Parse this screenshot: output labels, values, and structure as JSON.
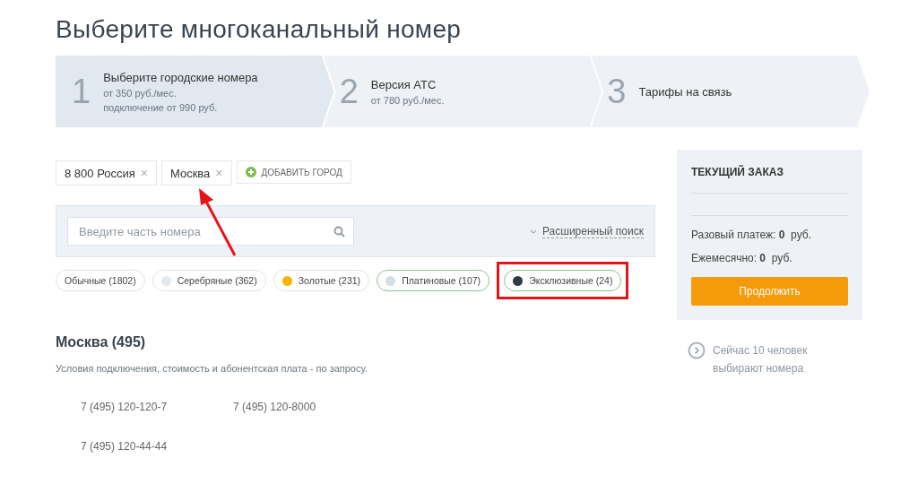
{
  "title": "Выберите многоканальный номер",
  "steps": [
    {
      "number": "1",
      "title": "Выберите городские номера",
      "lines": [
        "от 350 руб./мес.",
        "подключение от 990 руб."
      ],
      "selected": true
    },
    {
      "number": "2",
      "title": "Версия АТС",
      "lines": [
        "от 780 руб./мес."
      ],
      "selected": false
    },
    {
      "number": "3",
      "title": "Тарифы на связь",
      "selected": false
    }
  ],
  "cities": [
    {
      "label": "8 800 Россия",
      "remove": "×"
    },
    {
      "label": "Москва",
      "remove": "×"
    }
  ],
  "add_city": "ДОБАВИТЬ ГОРОД",
  "search": {
    "placeholder": "Введите часть номера",
    "advanced": "Расширенный поиск"
  },
  "categories": [
    {
      "label": "Обычные (1802)",
      "selected": false,
      "highlighted": false
    },
    {
      "label": "Серебряные (362)",
      "color": "#e3e9f0",
      "selected": false,
      "highlighted": false
    },
    {
      "label": "Золотые (231)",
      "color": "#f7b500",
      "selected": false,
      "highlighted": false
    },
    {
      "label": "Платиновые (107)",
      "color": "#d5dde5",
      "selected": true,
      "highlighted": false
    },
    {
      "label": "Эксклюзивные (24)",
      "color": "#2e3a44",
      "selected": true,
      "highlighted": true
    }
  ],
  "region": {
    "heading": "Москва (495)",
    "note": "Условия подключения, стоимость и абонентская плата - по запросу.",
    "numbers": [
      "7 (495) 120-120-7",
      "7 (495) 120-8000",
      "7 (495) 120-44-44"
    ]
  },
  "order": {
    "title": "ТЕКУЩИЙ ЗАКАЗ",
    "lines": [
      {
        "label": "Разовый платеж:",
        "amount": "0",
        "unit": "руб."
      },
      {
        "label": "Ежемесячно:",
        "amount": "0",
        "unit": "руб."
      }
    ],
    "button": "Продолжить"
  },
  "activity": "Сейчас 10 человек выбирают номера"
}
